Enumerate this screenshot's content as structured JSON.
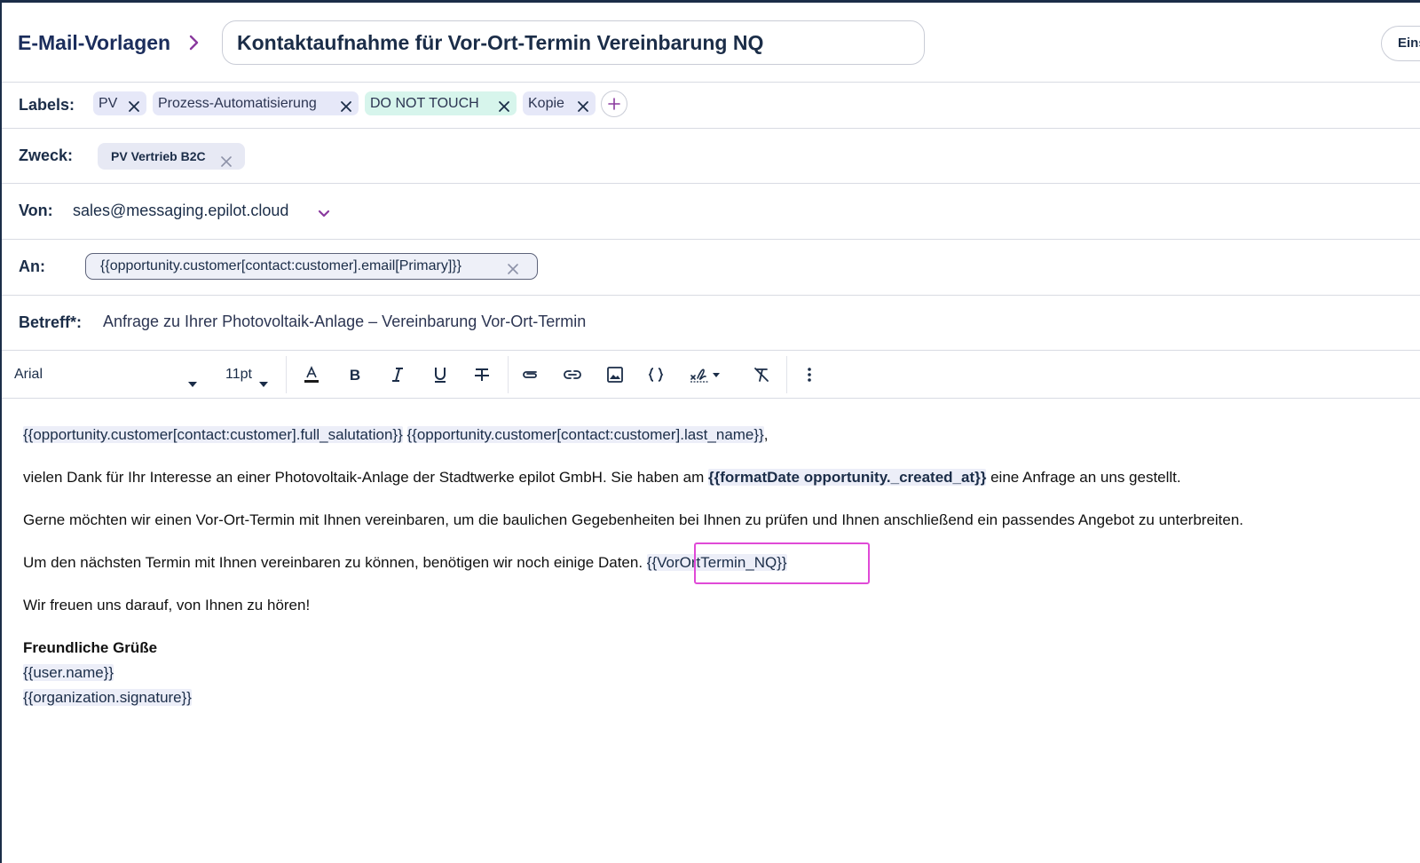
{
  "header": {
    "breadcrumb_root": "E-Mail-Vorlagen",
    "template_name": "Kontaktaufnahme für Vor-Ort-Termin Vereinbarung NQ",
    "settings_label": "Einstellungen"
  },
  "labels": {
    "label": "Labels:",
    "items": [
      {
        "text": "PV"
      },
      {
        "text": "Prozess-Automatisierung"
      },
      {
        "text": "DO NOT TOUCH"
      },
      {
        "text": "Kopie"
      }
    ]
  },
  "purpose": {
    "label": "Zweck:",
    "value": "PV Vertrieb B2C"
  },
  "from": {
    "label": "Von:",
    "value": "sales@messaging.epilot.cloud"
  },
  "to": {
    "label": "An:",
    "value": "{{opportunity.customer[contact:customer].email[Primary]}}"
  },
  "subject": {
    "label": "Betreff*:",
    "value": "Anfrage zu Ihrer Photovoltaik-Anlage – Vereinbarung Vor-Ort-Termin"
  },
  "toolbar": {
    "font": "Arial",
    "size": "11pt"
  },
  "body": {
    "line1_var1": "{{opportunity.customer[contact:customer].full_salutation}}",
    "line1_var2": "{{opportunity.customer[contact:customer].last_name}}",
    "line1_end": ",",
    "line2_text": "vielen Dank für Ihr Interesse an einer Photovoltaik-Anlage der Stadtwerke epilot GmbH. Sie haben am ",
    "line2_var": "{{formatDate opportunity._created_at}}",
    "line2_end": " eine Anfrage an uns gestellt.",
    "line3": "Gerne möchten wir einen Vor-Ort-Termin mit Ihnen vereinbaren, um die baulichen Gegebenheiten bei Ihnen zu prüfen und Ihnen anschließend ein passendes Angebot zu unterbreiten.",
    "line4_text": "Um den nächsten Termin mit Ihnen vereinbaren zu können, benötigen wir noch einige Daten. ",
    "line4_var": "{{VorOrtTermin_NQ}}",
    "line5": "Wir freuen uns darauf, von Ihnen zu hören!",
    "closing": "Freundliche Grüße",
    "user_var": "{{user.name}}",
    "signature_var": "{{organization.signature}}"
  },
  "colors": {
    "accent": "#8a3a9e",
    "highlight": "#e04ad7",
    "chip_lavender": "#e6e8f8",
    "chip_mint": "#d7f5ec"
  }
}
